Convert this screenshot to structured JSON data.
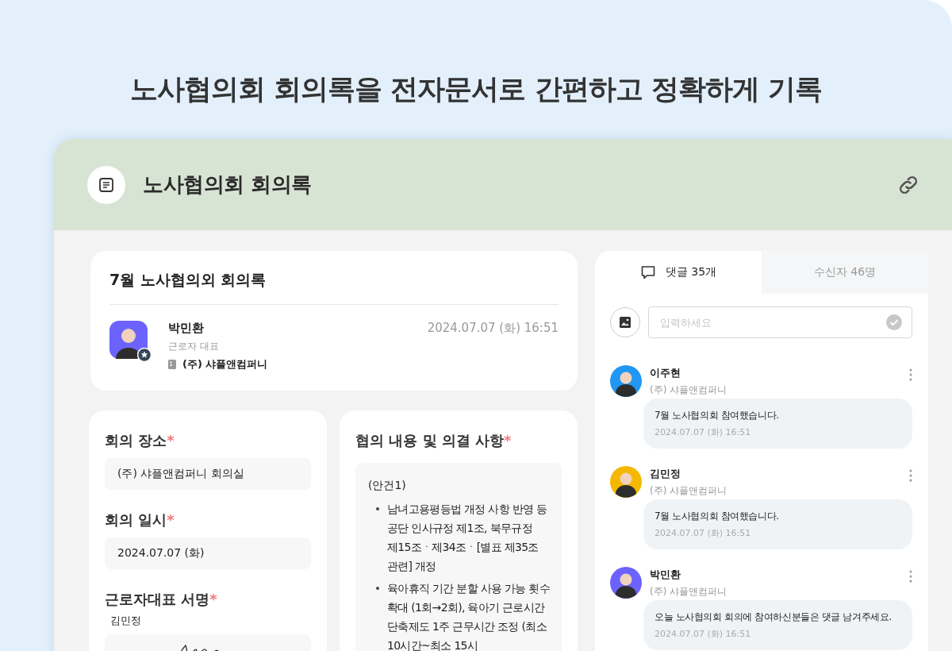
{
  "headline": "노사협의회 회의록을 전자문서로 간편하고 정확하게 기록",
  "window": {
    "title": "노사협의회 회의록"
  },
  "document": {
    "title": "7월 노사협의외 회의록",
    "author": {
      "name": "박민환",
      "role": "근로자 대표",
      "company": "(주) 샤플앤컴퍼니",
      "color": "#6c63ff"
    },
    "datetime": "2024.07.07 (화) 16:51"
  },
  "fields": [
    {
      "label": "회의 장소",
      "required_mark": "*",
      "value": "(주) 샤플앤컴퍼니 회의실"
    },
    {
      "label": "회의 일시",
      "required_mark": "*",
      "value": "2024.07.07 (화)"
    }
  ],
  "signature": {
    "label": "근로자대표 서명",
    "required_mark": "*",
    "signer": "김민정"
  },
  "agenda": {
    "label": "협의 내용 및 의결 사항",
    "required_mark": "*",
    "heading": "(안건1)",
    "items": [
      "남녀고용평등법 개정 사항 반영 등 공단 인사규정 제1조,  북무규정 제15조ㆍ제34조ㆍ[별표 제35조 관련] 개정",
      "육아휴직 기간 분할 사용 가능 횟수 확대 (1회→2회), 육아기 근로시간   단축제도 1주 근무시간 조정 (최소 10시간~최소 15시"
    ]
  },
  "tabs": [
    {
      "label": "댓글 35개",
      "selected": true
    },
    {
      "label": "수신자 46명",
      "selected": false
    }
  ],
  "comment_input": {
    "placeholder": "입력하세요"
  },
  "comments": [
    {
      "name": "이주현",
      "company": "(주) 샤플앤컴퍼니",
      "text": "7월 노사협의회 참여했습니다.",
      "time": "2024.07.07 (화) 16:51",
      "color": "#2196f3"
    },
    {
      "name": "김민정",
      "company": "(주) 샤플앤컴퍼니",
      "text": "7월 노사협의회 참여했습니다.",
      "time": "2024.07.07 (화) 16:51",
      "color": "#f5b800"
    },
    {
      "name": "박민환",
      "company": "(주) 샤플앤컴퍼니",
      "text": "오늘 노사협의회 회의에 참여하신분들은 댓글 남겨주세요.",
      "time": "2024.07.07 (화) 16:51",
      "color": "#6c63ff"
    }
  ]
}
